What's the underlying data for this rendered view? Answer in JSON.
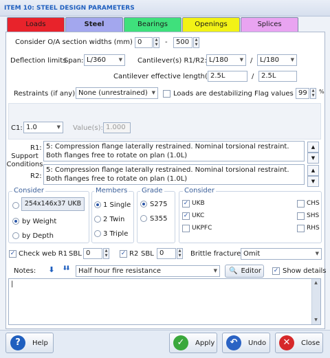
{
  "title": "ITEM 10: STEEL DESIGN PARAMETERS",
  "tabs": [
    {
      "label": "Loads",
      "color": "#e8232b"
    },
    {
      "label": "Steel",
      "color": "#a3a7ee"
    },
    {
      "label": "Bearings",
      "color": "#3fe07c"
    },
    {
      "label": "Openings",
      "color": "#f2f216"
    },
    {
      "label": "Splices",
      "color": "#e9a4f1"
    }
  ],
  "section_widths": {
    "label": "Consider O/A section widths (mm) of",
    "min": "0",
    "dash": "-",
    "max": "500"
  },
  "deflection": {
    "label": "Deflection limits",
    "span_label": "Span:",
    "span": "L/360",
    "cant_label": "Cantilever(s)  R1/R2:",
    "cant_r1": "L/180",
    "slash": "/",
    "cant_r2": "L/180"
  },
  "cant_eff": {
    "label": "Cantilever effective length(s):",
    "r1": "2.5L",
    "r2": "2.5L"
  },
  "restraints": {
    "label": "Restraints (if any):",
    "value": "None (unrestrained)",
    "destab_label": "Loads are destabilizing",
    "flag_label": "Flag values >",
    "flag_value": "99",
    "flag_unit": "%"
  },
  "c1": {
    "label": "C1:",
    "value": "1.0",
    "value_label": "Value(s):",
    "value_placeholder": "1.000"
  },
  "support": {
    "label": "Support Conditions",
    "r1_label": "R1:",
    "r1_text": "5: Compression flange laterally restrained. Nominal torsional restraint. Both flanges free to rotate on plan (1.0L)",
    "r2_label": "R2:",
    "r2_text": "5: Compression flange laterally restrained. Nominal torsional restraint. Both flanges free to rotate on plan (1.0L)"
  },
  "consider": {
    "title": "Consider",
    "section": "254x146x37 UKB",
    "by_weight": "by Weight",
    "by_depth": "by Depth"
  },
  "members": {
    "title": "Members",
    "single": "1 Single",
    "twin": "2 Twin",
    "triple": "3 Triple"
  },
  "grade": {
    "title": "Grade",
    "s275": "S275",
    "s355": "S355"
  },
  "consider2": {
    "title": "Consider",
    "ukb": "UKB",
    "ukc": "UKC",
    "ukpfc": "UKPFC",
    "chs": "CHS",
    "shs": "SHS",
    "rhs": "RHS"
  },
  "web": {
    "check_label": "Check web R1",
    "sbl1_label": "SBL",
    "sbl1": "0",
    "r2_label": "R2",
    "sbl2_label": "SBL",
    "sbl2": "0",
    "brittle_label": "Brittle fracture:",
    "brittle": "Omit"
  },
  "notes": {
    "label": "Notes:",
    "value": "Half hour fire resistance",
    "editor": "Editor",
    "show_details": "Show details",
    "text": "|"
  },
  "footer": {
    "help": "Help",
    "apply": "Apply",
    "undo": "Undo",
    "close": "Close"
  }
}
